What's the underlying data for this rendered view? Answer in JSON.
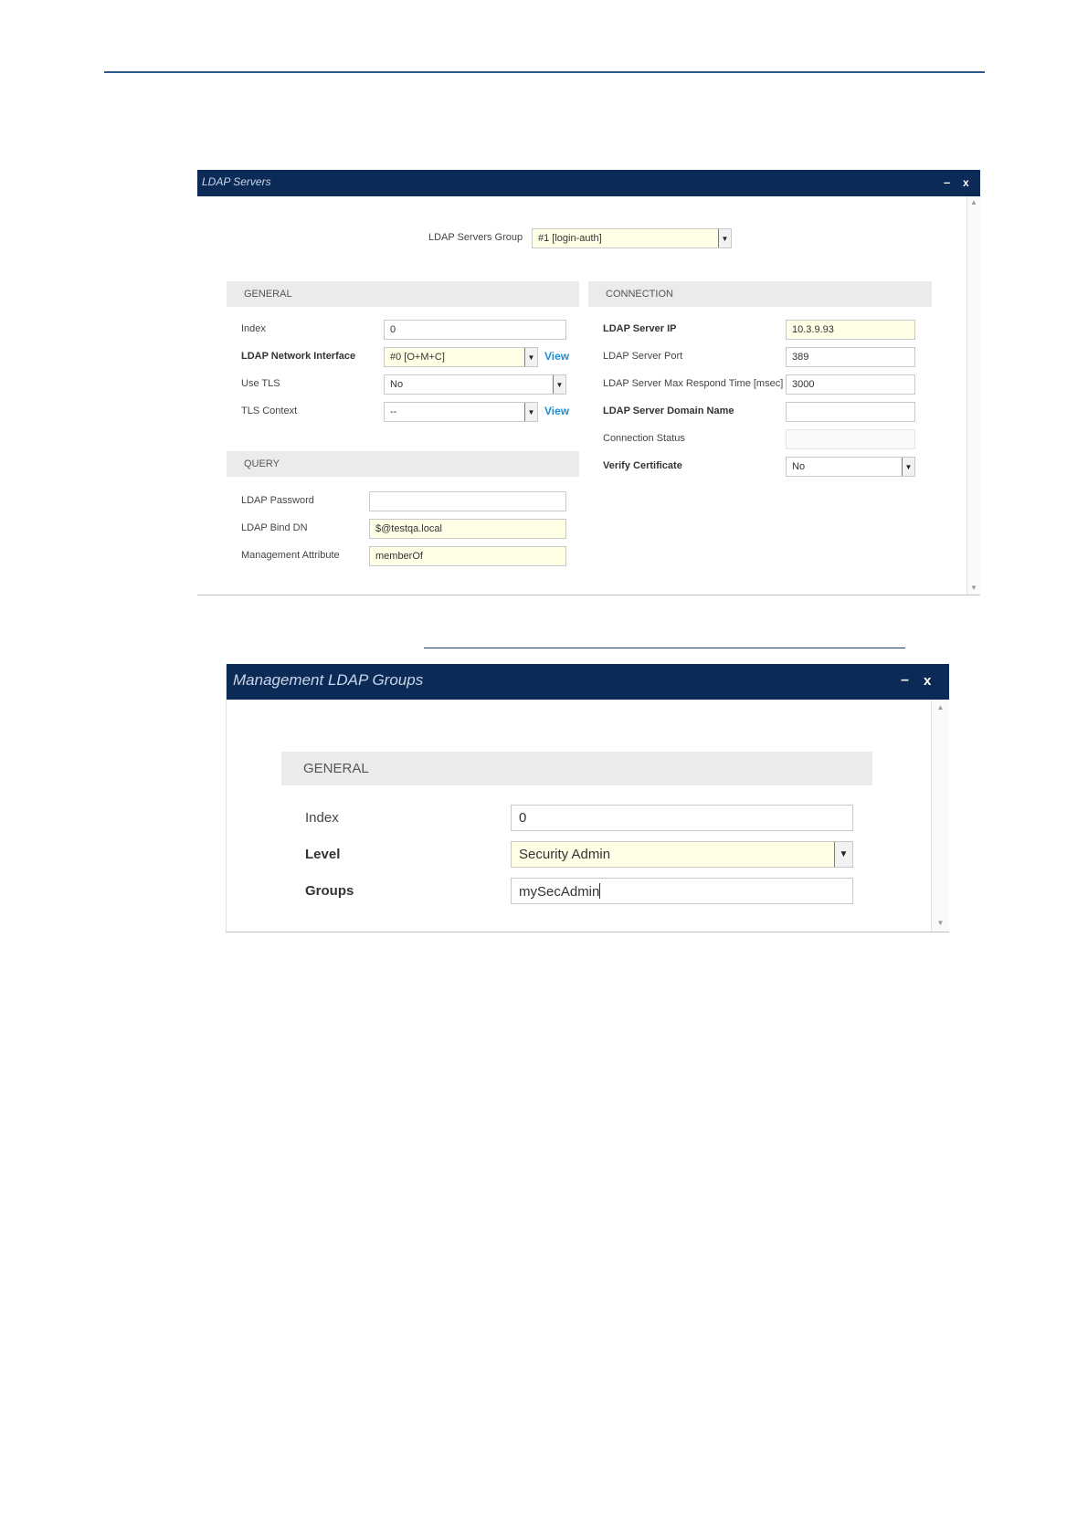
{
  "ldap_servers": {
    "title": "LDAP Servers",
    "minimize": "–",
    "close": "x",
    "group_label": "LDAP Servers Group",
    "group_value": "#1 [login-auth]",
    "general": {
      "header": "GENERAL",
      "index_label": "Index",
      "index_value": "0",
      "network_interface_label": "LDAP Network Interface",
      "network_interface_value": "#0 [O+M+C]",
      "view_link": "View",
      "use_tls_label": "Use TLS",
      "use_tls_value": "No",
      "tls_context_label": "TLS Context",
      "tls_context_value": "--"
    },
    "connection": {
      "header": "CONNECTION",
      "server_ip_label": "LDAP Server IP",
      "server_ip_value": "10.3.9.93",
      "server_port_label": "LDAP Server Port",
      "server_port_value": "389",
      "max_respond_label": "LDAP Server Max Respond Time [msec]",
      "max_respond_value": "3000",
      "domain_name_label": "LDAP Server Domain Name",
      "domain_name_value": "",
      "connection_status_label": "Connection Status",
      "connection_status_value": "",
      "verify_cert_label": "Verify Certificate",
      "verify_cert_value": "No"
    },
    "query": {
      "header": "QUERY",
      "password_label": "LDAP Password",
      "password_value": "",
      "bind_dn_label": "LDAP Bind DN",
      "bind_dn_value": "$@testqa.local",
      "mgmt_attr_label": "Management Attribute",
      "mgmt_attr_value": "memberOf"
    }
  },
  "ldap_groups": {
    "title": "Management LDAP Groups",
    "minimize": "–",
    "close": "x",
    "general": {
      "header": "GENERAL",
      "index_label": "Index",
      "index_value": "0",
      "level_label": "Level",
      "level_value": "Security Admin",
      "groups_label": "Groups",
      "groups_value": "mySecAdmin"
    }
  },
  "colors": {
    "titlebar": "#0b2a55",
    "section_header": "#ebebeb",
    "highlight_field": "#ffffe6",
    "link": "#1b8fd6"
  }
}
